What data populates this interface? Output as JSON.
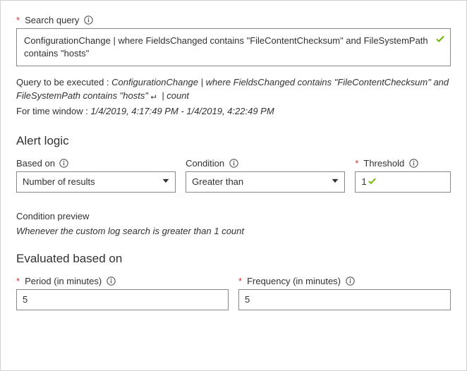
{
  "searchQuery": {
    "label": "Search query",
    "value": "ConfigurationChange | where FieldsChanged contains \"FileContentChecksum\" and FileSystemPath contains \"hosts\""
  },
  "queryDescription": {
    "prefix": "Query to be executed : ",
    "body": "ConfigurationChange | where FieldsChanged contains \"FileContentChecksum\" and FileSystemPath contains \"hosts\" ",
    "suffix": "| count",
    "timePrefix": "For time window : ",
    "timeRange": "1/4/2019, 4:17:49 PM - 1/4/2019, 4:22:49 PM"
  },
  "alertLogic": {
    "title": "Alert logic",
    "basedOn": {
      "label": "Based on",
      "value": "Number of results"
    },
    "condition": {
      "label": "Condition",
      "value": "Greater than"
    },
    "threshold": {
      "label": "Threshold",
      "value": "1"
    }
  },
  "conditionPreview": {
    "label": "Condition preview",
    "text": "Whenever the custom log search is greater than 1 count"
  },
  "evaluated": {
    "title": "Evaluated based on",
    "period": {
      "label": "Period (in minutes)",
      "value": "5"
    },
    "frequency": {
      "label": "Frequency (in minutes)",
      "value": "5"
    }
  }
}
